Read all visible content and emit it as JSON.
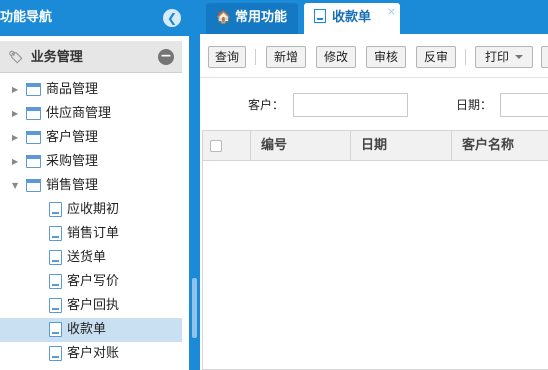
{
  "nav": {
    "title": "功能导航",
    "collapse_icon": "chevron-left-icon",
    "group": {
      "title": "业务管理",
      "icon": "tag-icon",
      "toggle_icon": "minus-icon"
    },
    "tree": [
      {
        "label": "商品管理",
        "expanded": false
      },
      {
        "label": "供应商管理",
        "expanded": false
      },
      {
        "label": "客户管理",
        "expanded": false
      },
      {
        "label": "采购管理",
        "expanded": false
      },
      {
        "label": "销售管理",
        "expanded": true
      }
    ],
    "sales_items": [
      {
        "label": "应收期初",
        "selected": false
      },
      {
        "label": "销售订单",
        "selected": false
      },
      {
        "label": "送货单",
        "selected": false
      },
      {
        "label": "客户写价",
        "selected": false
      },
      {
        "label": "客户回执",
        "selected": false
      },
      {
        "label": "收款单",
        "selected": true
      },
      {
        "label": "客户对账",
        "selected": false
      }
    ]
  },
  "tabs": {
    "common_label": "常用功能",
    "active_label": "收款单",
    "close_glyph": "×"
  },
  "toolbar": {
    "query": "查询",
    "add": "新增",
    "edit": "修改",
    "audit": "审核",
    "unaudit": "反审",
    "print": "打印"
  },
  "filters": {
    "customer_label": "客户：",
    "customer_value": "",
    "date_label": "日期：",
    "date_value": ""
  },
  "grid": {
    "columns": [
      "编号",
      "日期",
      "客户名称"
    ]
  },
  "colors": {
    "accent": "#1b8bd8",
    "selection": "#c9e0f3"
  }
}
